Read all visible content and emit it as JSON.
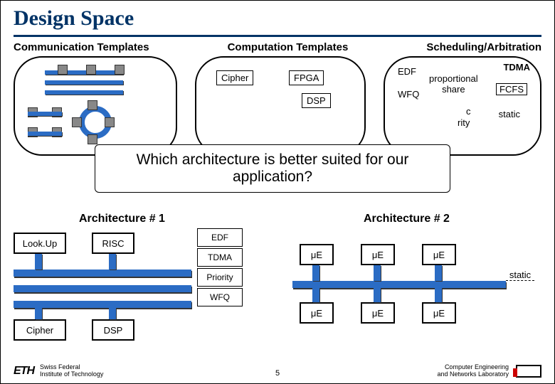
{
  "title": "Design Space",
  "columns": {
    "comm": "Communication Templates",
    "comp": "Computation Templates",
    "sched": "Scheduling/Arbitration"
  },
  "comp_chips": {
    "cipher": "Cipher",
    "fpga": "FPGA",
    "dsp": "DSP"
  },
  "sched_labels": {
    "edf": "EDF",
    "tdma": "TDMA",
    "wfq": "WFQ",
    "prop": "proportional\nshare",
    "fcfs": "FCFS",
    "static": "static",
    "dynpri_a": "c",
    "dynpri_b": "rity"
  },
  "question": "Which architecture is better suited for our application?",
  "arch1": {
    "heading": "Architecture # 1",
    "lookup": "Look.Up",
    "risc": "RISC",
    "cipher": "Cipher",
    "dsp": "DSP",
    "sched": [
      "EDF",
      "TDMA",
      "Priority",
      "WFQ"
    ]
  },
  "arch2": {
    "heading": "Architecture # 2",
    "me": "μE",
    "static": "static"
  },
  "footer": {
    "eth": "ETH",
    "inst": "Swiss Federal\nInstitute of Technology",
    "lab": "Computer Engineering\nand Networks Laboratory",
    "page": "5"
  }
}
